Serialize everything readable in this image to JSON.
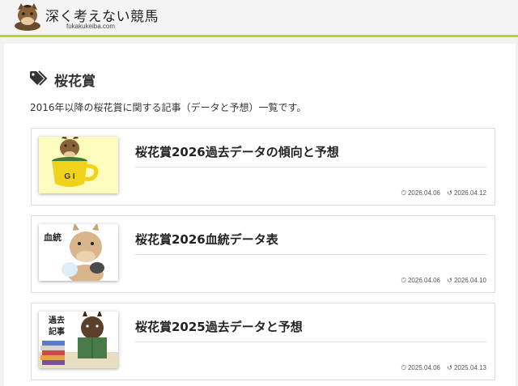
{
  "site": {
    "title": "深く考えない競馬",
    "url": "fukakukeiba.com"
  },
  "category": {
    "title": "桜花賞",
    "description": "2016年以降の桜花賞に関する記事（データと予想）一覧です。"
  },
  "posts": [
    {
      "title": "桜花賞2026過去データの傾向と予想",
      "thumb_text": "G I",
      "published": "2026.04.06",
      "updated": "2026.04.12"
    },
    {
      "title": "桜花賞2026血統データ表",
      "thumb_text": "血統",
      "published": "2026.04.06",
      "updated": "2026.04.10"
    },
    {
      "title": "桜花賞2025過去データと予想",
      "thumb_text_1": "過去",
      "thumb_text_2": "記事",
      "published": "2025.04.06",
      "updated": "2025.04.13"
    }
  ],
  "icons": {
    "category": "tag-icon",
    "published": "clock-icon",
    "updated": "history-icon"
  },
  "colors": {
    "accent_bar": "#b7d334",
    "title_underline": "#f3d6d6"
  }
}
